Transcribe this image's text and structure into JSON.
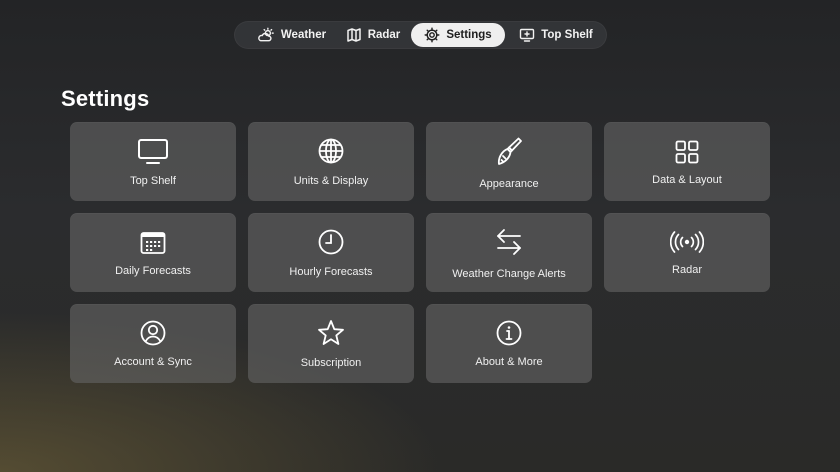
{
  "nav": {
    "tabs": [
      {
        "label": "Weather",
        "icon": "cloud-sun-icon"
      },
      {
        "label": "Radar",
        "icon": "map-icon"
      },
      {
        "label": "Settings",
        "icon": "gear-icon",
        "selected": true
      },
      {
        "label": "Top Shelf",
        "icon": "tv-plus-icon"
      }
    ]
  },
  "page": {
    "title": "Settings"
  },
  "tiles": [
    {
      "label": "Top Shelf",
      "icon": "tv-icon"
    },
    {
      "label": "Units & Display",
      "icon": "globe-icon"
    },
    {
      "label": "Appearance",
      "icon": "paintbrush-icon"
    },
    {
      "label": "Data & Layout",
      "icon": "grid-icon"
    },
    {
      "label": "Daily Forecasts",
      "icon": "calendar-icon"
    },
    {
      "label": "Hourly Forecasts",
      "icon": "clock-icon"
    },
    {
      "label": "Weather Change Alerts",
      "icon": "arrows-left-right-icon"
    },
    {
      "label": "Radar",
      "icon": "broadcast-icon"
    },
    {
      "label": "Account & Sync",
      "icon": "person-circle-icon"
    },
    {
      "label": "Subscription",
      "icon": "star-icon"
    },
    {
      "label": "About & More",
      "icon": "info-circle-icon"
    }
  ],
  "colors": {
    "accent_selected_tab": "#efefef",
    "tile_background": "#646464",
    "text": "#ffffff"
  }
}
